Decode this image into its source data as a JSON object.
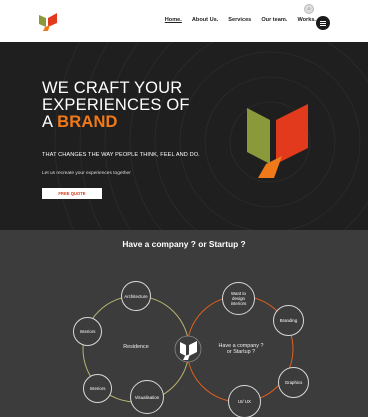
{
  "nav": {
    "items": [
      {
        "label": "Home.",
        "active": true
      },
      {
        "label": "About Us.",
        "active": false
      },
      {
        "label": "Services",
        "active": false
      },
      {
        "label": "Our team.",
        "active": false
      },
      {
        "label": "Works.",
        "active": false
      }
    ]
  },
  "hero": {
    "title_line1": "WE CRAFT YOUR",
    "title_line2": "EXPERIENCES OF",
    "title_line3_prefix": "A ",
    "title_line3_brand": "BRAND",
    "tagline": "THAT CHANGES THE WAY PEOPLE THINK, FEEL AND DO.",
    "subline": "Let us recreate your experiences together",
    "cta_label": "FREE QUOTE"
  },
  "company": {
    "title": "Have a company ? or Startup ?",
    "left_ring_label": "Residence",
    "right_ring_label_line1": "Have a company ?",
    "right_ring_label_line2": "or Startup ?",
    "left_bubbles": [
      "Architecture",
      "Interiors",
      "Interiors",
      "Visualisation"
    ],
    "right_bubbles": [
      "Want to design interiors",
      "Branding",
      "Graphics",
      "UI/ UX"
    ]
  },
  "colors": {
    "logo_green": "#8a9a3a",
    "logo_red": "#e23a1c",
    "logo_orange": "#f07a1a",
    "hero_bg": "#1f1f1f",
    "section_bg": "#3c3c3c"
  }
}
